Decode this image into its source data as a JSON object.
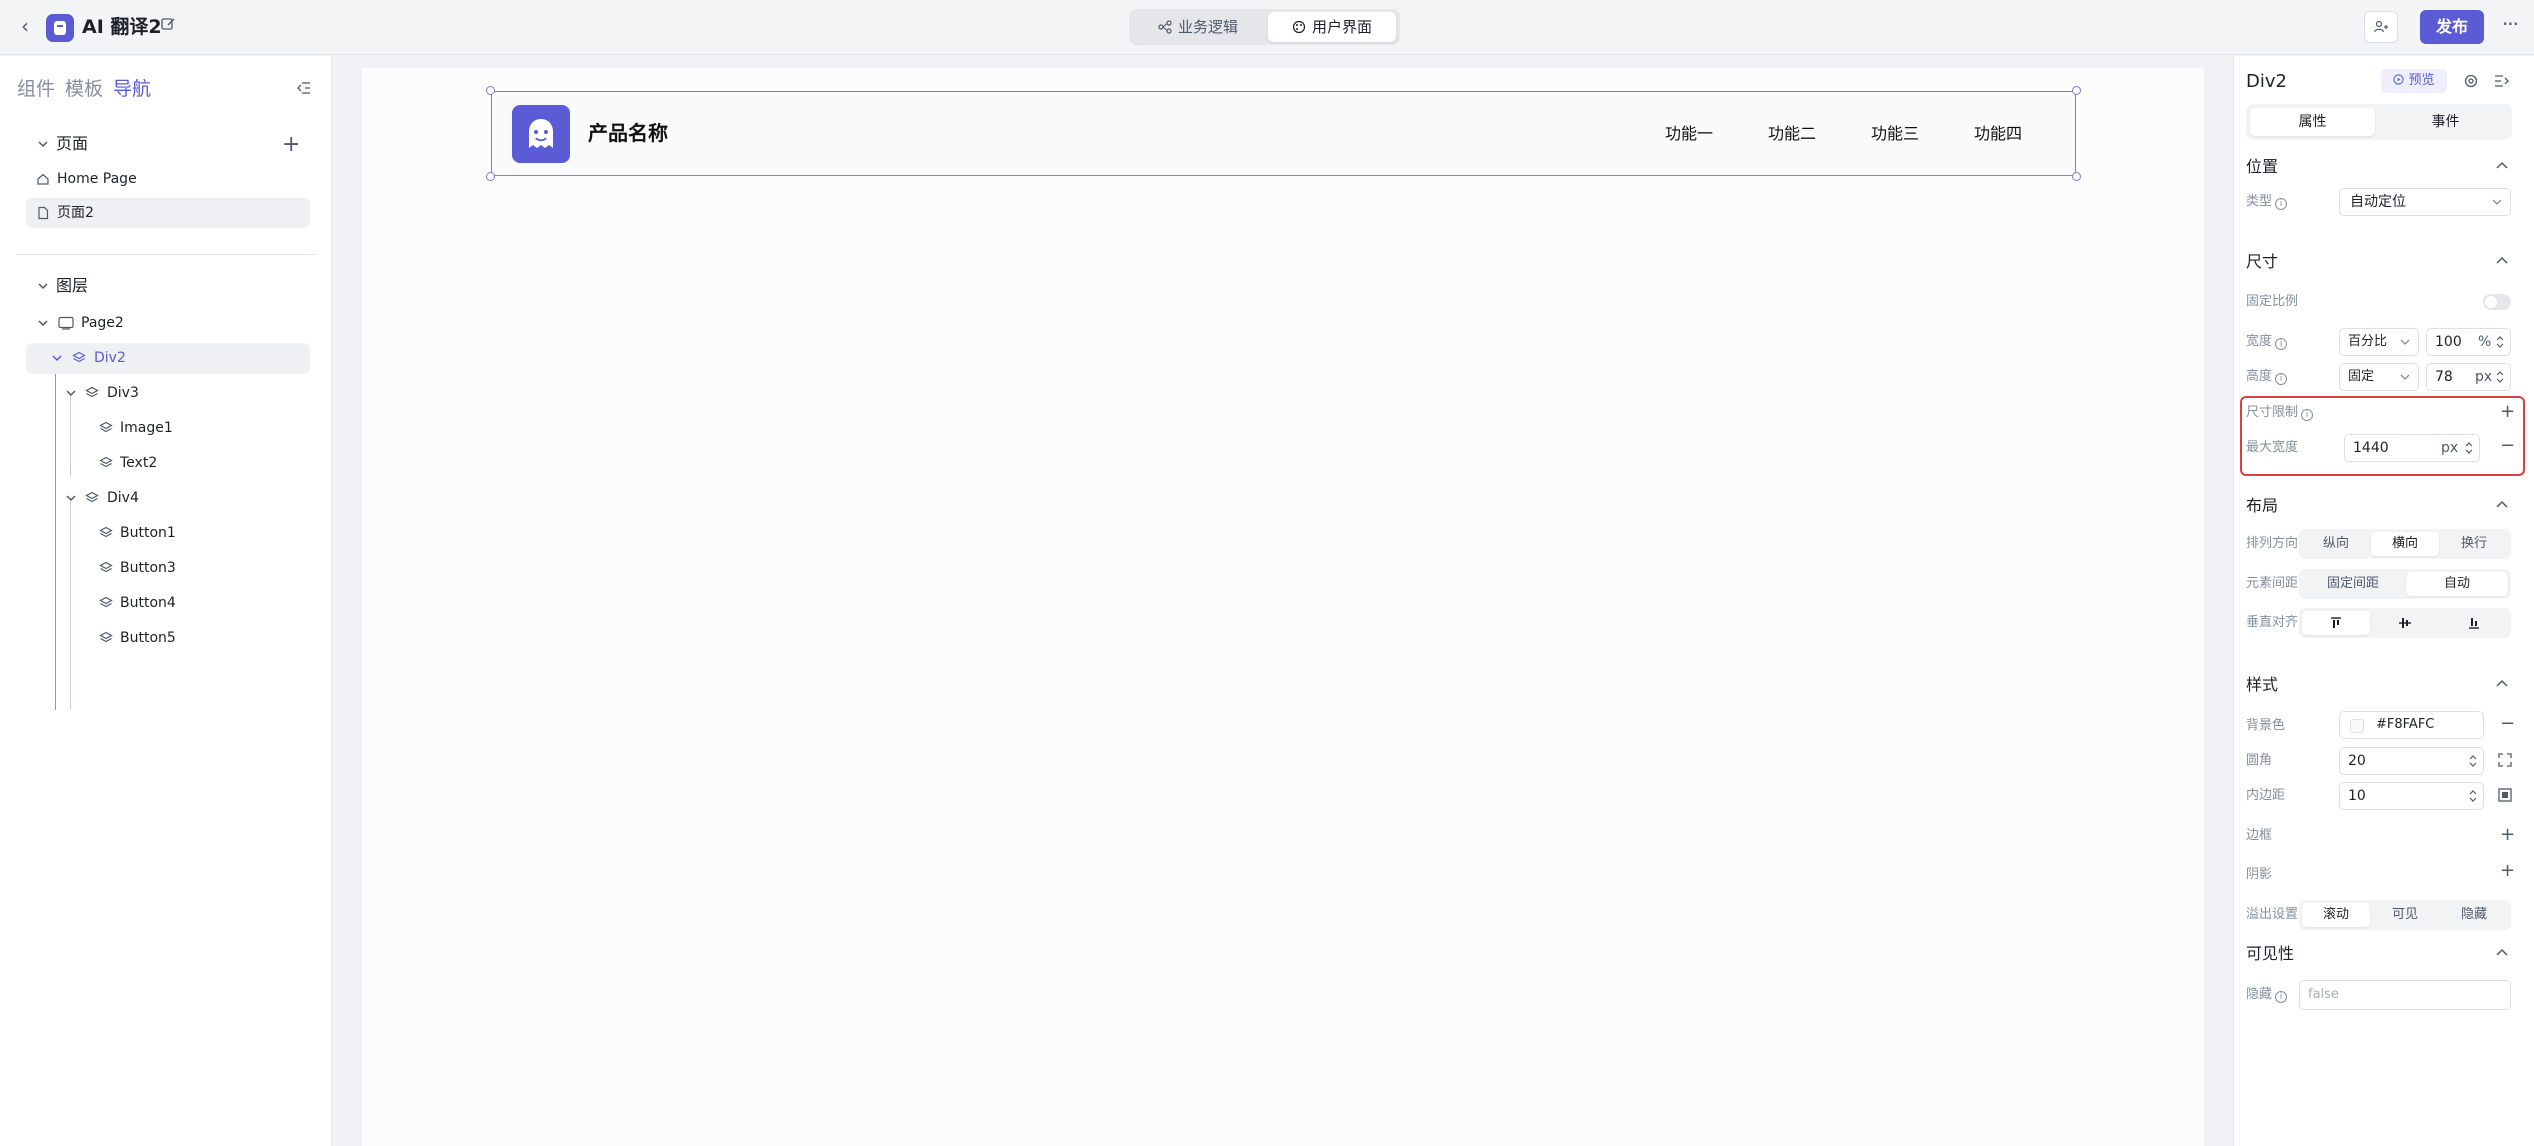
{
  "topbar": {
    "title": "AI 翻译2",
    "tabs": [
      {
        "label": "业务逻辑",
        "icon": "logic-flow-icon",
        "active": false
      },
      {
        "label": "用户界面",
        "icon": "palette-icon",
        "active": true
      }
    ],
    "publish_label": "发布",
    "accent": "#5B5BD6"
  },
  "left_panel": {
    "tabs": [
      "组件",
      "模板",
      "导航"
    ],
    "active_tab": "导航",
    "pages_section": "页面",
    "pages": [
      "Home Page",
      "页面2"
    ],
    "selected_page": "页面2",
    "layers_section": "图层",
    "layers": [
      {
        "label": "Page2"
      },
      {
        "label": "Div2",
        "selected": true
      },
      {
        "label": "Div3"
      },
      {
        "label": "Image1"
      },
      {
        "label": "Text2"
      },
      {
        "label": "Div4"
      },
      {
        "label": "Button1"
      },
      {
        "label": "Button3"
      },
      {
        "label": "Button4"
      },
      {
        "label": "Button5"
      }
    ]
  },
  "canvas": {
    "product_name": "产品名称",
    "nav_buttons": [
      "功能一",
      "功能二",
      "功能三",
      "功能四"
    ]
  },
  "right_panel": {
    "title": "Div2",
    "preview_label": "预览",
    "tabs": [
      "属性",
      "事件"
    ],
    "active_tab": "属性",
    "position": {
      "section": "位置",
      "type_label": "类型",
      "type_value": "自动定位"
    },
    "size": {
      "section": "尺寸",
      "fixed_ratio_label": "固定比例",
      "fixed_ratio_on": false,
      "width_label": "宽度",
      "width_mode": "百分比",
      "width_value": "100",
      "width_unit": "%",
      "height_label": "高度",
      "height_mode": "固定",
      "height_value": "78",
      "height_unit": "px",
      "limit_label": "尺寸限制",
      "max_width_label": "最大宽度",
      "max_width_value": "1440",
      "max_width_unit": "px"
    },
    "layout": {
      "section": "布局",
      "direction_label": "排列方向",
      "direction_options": [
        "纵向",
        "横向",
        "换行"
      ],
      "direction_active": "横向",
      "gap_label": "元素间距",
      "gap_options": [
        "固定间距",
        "自动"
      ],
      "gap_active": "自动",
      "valign_label": "垂直对齐"
    },
    "style": {
      "section": "样式",
      "bg_label": "背景色",
      "bg_value": "#F8FAFC",
      "radius_label": "圆角",
      "radius_value": "20",
      "padding_label": "内边距",
      "padding_value": "10",
      "border_label": "边框",
      "shadow_label": "阴影",
      "overflow_label": "溢出设置",
      "overflow_options": [
        "滚动",
        "可见",
        "隐藏"
      ],
      "overflow_active": "滚动"
    },
    "visibility": {
      "section": "可见性",
      "hidden_label": "隐藏",
      "hidden_placeholder": "false"
    }
  }
}
